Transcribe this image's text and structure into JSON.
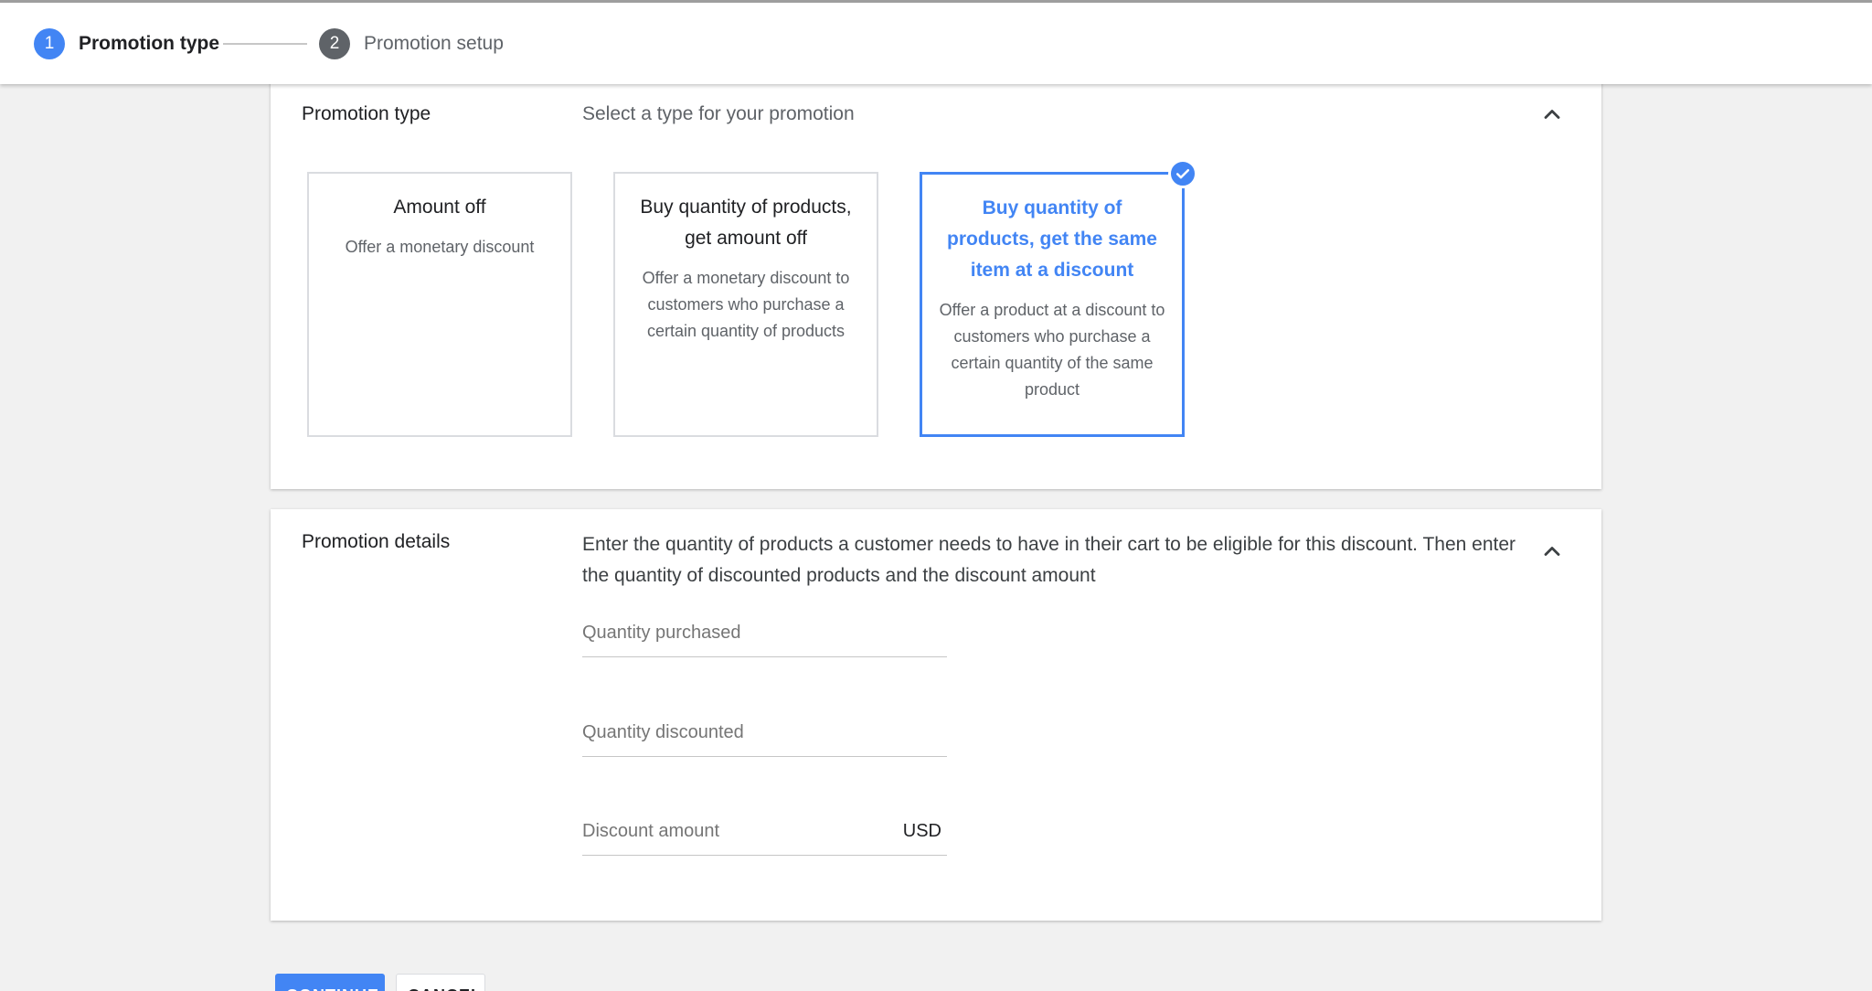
{
  "stepper": {
    "steps": [
      {
        "number": "1",
        "label": "Promotion type"
      },
      {
        "number": "2",
        "label": "Promotion setup"
      }
    ]
  },
  "promotion_type": {
    "title": "Promotion type",
    "description": "Select a type for your promotion",
    "options": [
      {
        "title": "Amount off",
        "description": "Offer a monetary discount"
      },
      {
        "title": "Buy quantity of products, get amount off",
        "description": "Offer a monetary discount to customers who purchase a certain quantity of products"
      },
      {
        "title": "Buy quantity of products, get the same item at a discount",
        "description": "Offer a product at a discount to customers who purchase a certain quantity of the same product"
      }
    ],
    "selected_index": 2
  },
  "promotion_details": {
    "title": "Promotion details",
    "description": "Enter the quantity of products a customer needs to have in their cart to be eligible for this discount. Then enter the quantity of discounted products and the discount amount",
    "fields": [
      {
        "placeholder": "Quantity purchased",
        "value": ""
      },
      {
        "placeholder": "Quantity discounted",
        "value": ""
      },
      {
        "placeholder": "Discount amount",
        "value": "",
        "suffix": "USD"
      }
    ]
  },
  "actions": {
    "continue_label": "CONTINUE",
    "cancel_label": "CANCEL"
  },
  "colors": {
    "accent": "#4285f4",
    "inactive_step": "#5f6368",
    "background": "#f1f1f1"
  },
  "icons": {
    "collapse": "chevron-up-icon",
    "selected": "check-circle-icon"
  }
}
